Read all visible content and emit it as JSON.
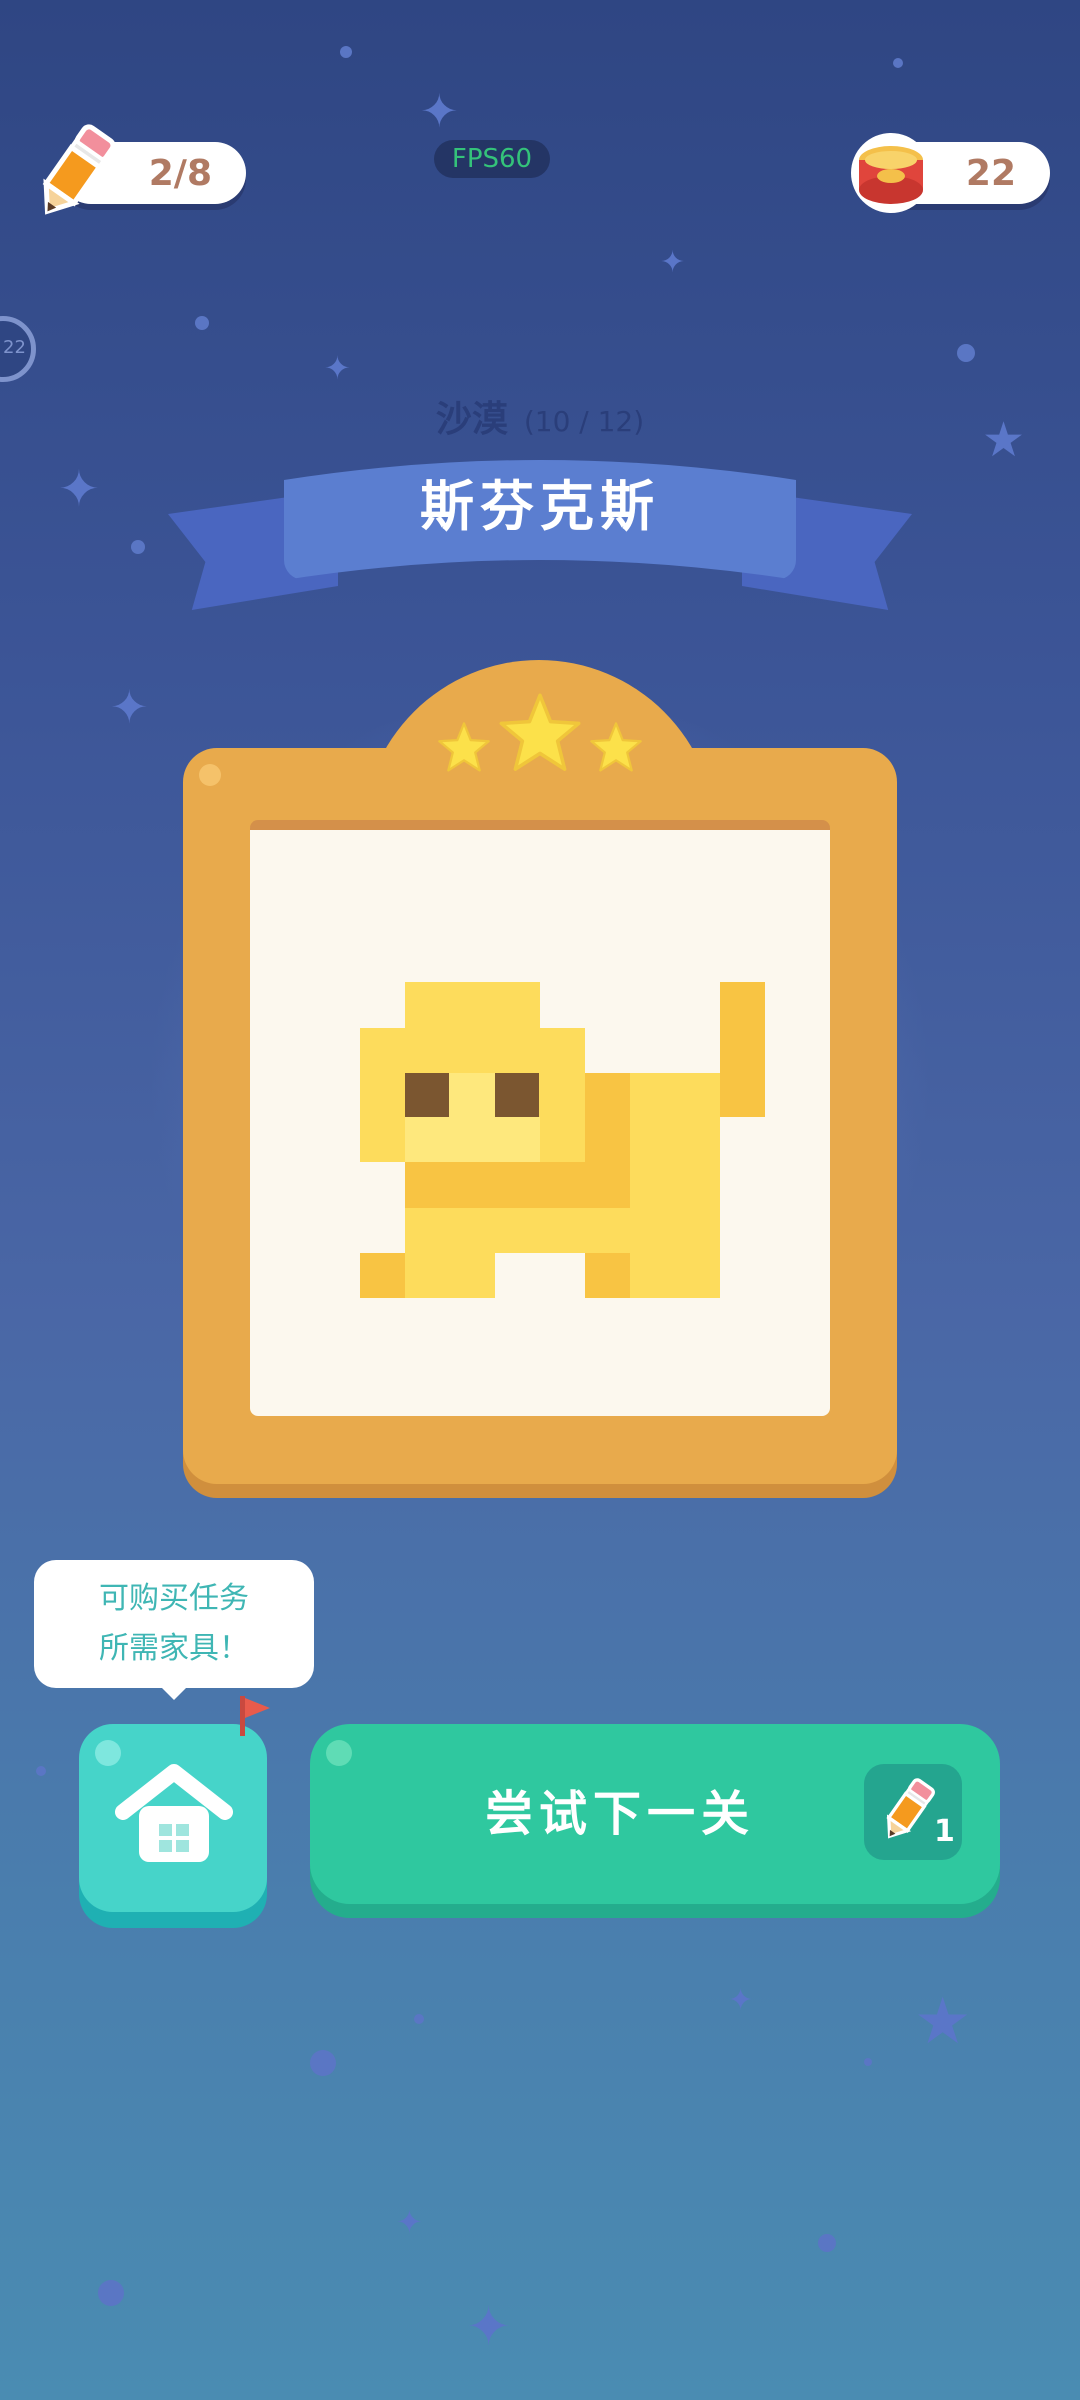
{
  "hud": {
    "pencil_count": "2/8",
    "coin_count": "22",
    "fps": "FPS60",
    "side_badge": "22"
  },
  "level": {
    "region": "沙漠",
    "progress": "(10 / 12)",
    "title": "斯芬克斯",
    "stars_earned": 3,
    "stars_total": 3
  },
  "tip_bubble": {
    "line1": "可购买任务",
    "line2": "所需家具！"
  },
  "buttons": {
    "next_label": "尝试下一关",
    "next_cost": "1"
  },
  "colors": {
    "background_top": "#2f4683",
    "background_bottom": "#4a8cb2",
    "frame": "#e8aa4c",
    "ribbon": "#5b7ed0",
    "home_button": "#46d4c9",
    "next_button": "#2fc89f",
    "pixel_light": "#fddc5c",
    "pixel_mid": "#f8c443",
    "pixel_pale": "#fee87d",
    "pixel_eye": "#7b5630"
  }
}
